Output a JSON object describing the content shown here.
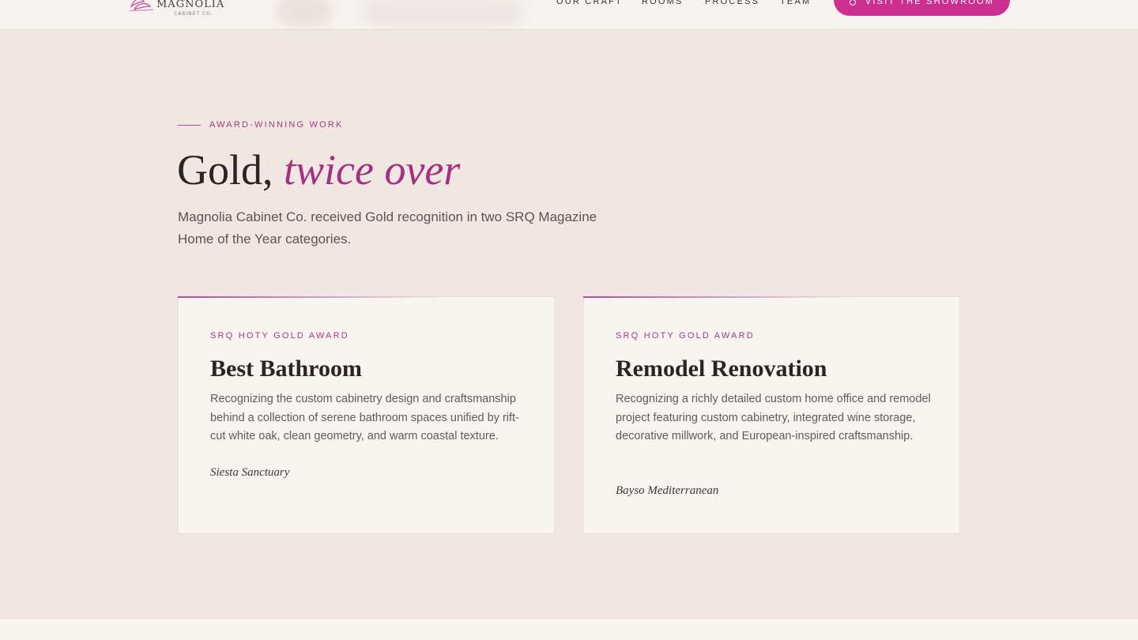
{
  "header": {
    "logo": {
      "name": "MAGNOLIA",
      "sub": "CABINET CO."
    },
    "nav": [
      {
        "label": "OUR CRAFT"
      },
      {
        "label": "ROOMS"
      },
      {
        "label": "PROCESS"
      },
      {
        "label": "TEAM"
      }
    ],
    "cta": {
      "label": "VISIT THE SHOWROOM",
      "icon": "pin-icon"
    }
  },
  "section": {
    "eyebrow": "AWARD-WINNING WORK",
    "headline_plain": "Gold,",
    "headline_accent": "twice over",
    "lead": "Magnolia Cabinet Co. received Gold recognition in two SRQ Magazine Home of the Year categories."
  },
  "awards": [
    {
      "label": "SRQ HOTY GOLD AWARD",
      "title": "Best Bathroom",
      "body": "Recognizing the custom cabinetry design and craftsmanship behind a collection of serene bathroom spaces unified by rift-cut white oak, clean geometry, and warm coastal texture.",
      "project": "Siesta Sanctuary"
    },
    {
      "label": "SRQ HOTY GOLD AWARD",
      "title": "Remodel Renovation",
      "body": "Recognizing a richly detailed custom home office and remodel project featuring custom cabinetry, integrated wine storage, decorative millwork, and European-inspired craftsmanship.",
      "project": "Bayso Mediterranean"
    }
  ],
  "colors": {
    "accent": "#a83883",
    "cta": "#cc2f8f",
    "background": "#f0e6e2",
    "card": "#f8f5f1"
  }
}
